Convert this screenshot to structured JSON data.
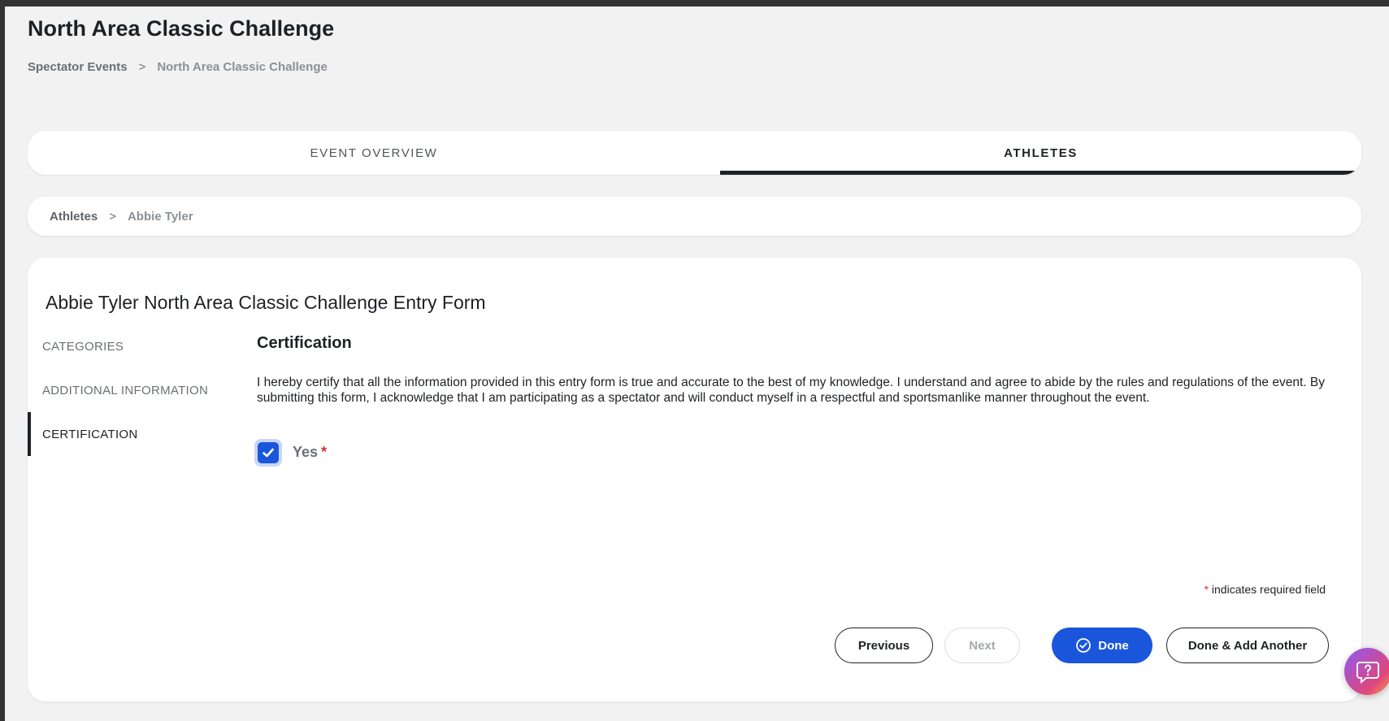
{
  "header": {
    "title": "North Area Classic Challenge",
    "breadcrumb": {
      "root": "Spectator Events",
      "separator": ">",
      "current": "North Area Classic Challenge"
    }
  },
  "tabs": [
    {
      "label": "EVENT OVERVIEW",
      "active": false
    },
    {
      "label": "ATHLETES",
      "active": true
    }
  ],
  "sub_breadcrumb": {
    "root": "Athletes",
    "separator": ">",
    "current": "Abbie Tyler"
  },
  "form": {
    "title": "Abbie Tyler North Area Classic Challenge Entry Form",
    "sections": [
      {
        "label": "CATEGORIES",
        "active": false
      },
      {
        "label": "ADDITIONAL INFORMATION",
        "active": false
      },
      {
        "label": "CERTIFICATION",
        "active": true
      }
    ],
    "certification": {
      "heading": "Certification",
      "text": "I hereby certify that all the information provided in this entry form is true and accurate to the best of my knowledge. I understand and agree to abide by the rules and regulations of the event. By submitting this form, I acknowledge that I am participating as a spectator and will conduct myself in a respectful and sportsmanlike manner throughout the event.",
      "checkbox_label": "Yes",
      "checked": true,
      "required_marker": "*"
    },
    "required_note": "indicates required field"
  },
  "actions": {
    "previous": "Previous",
    "next": "Next",
    "done": "Done",
    "done_add_another": "Done & Add Another"
  },
  "colors": {
    "accent": "#1a56db",
    "required": "#d92c2c",
    "text_dark": "#1e2124"
  },
  "icons": {
    "checkbox_icon": "check-icon",
    "done_icon": "check-circle-icon",
    "help_icon": "help-chat-icon"
  }
}
